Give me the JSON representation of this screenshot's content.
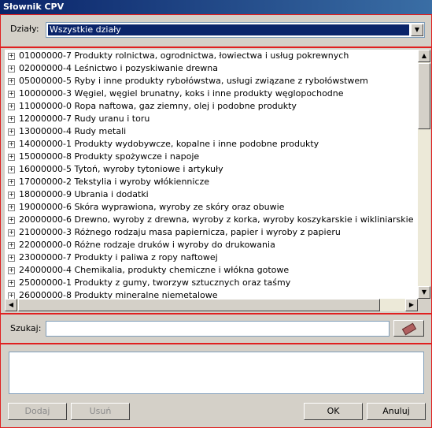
{
  "window": {
    "title": "Słownik CPV"
  },
  "filter": {
    "label": "Działy:",
    "selected": "Wszystkie działy"
  },
  "tree": {
    "items": [
      "01000000-7 Produkty rolnictwa, ogrodnictwa, łowiectwa i usług pokrewnych",
      "02000000-4 Leśnictwo i pozyskiwanie drewna",
      "05000000-5 Ryby i inne produkty rybołówstwa, usługi związane z rybołówstwem",
      "10000000-3 Węgiel, węgiel brunatny, koks i inne produkty węglopochodne",
      "11000000-0 Ropa naftowa, gaz ziemny, olej i podobne produkty",
      "12000000-7 Rudy uranu i toru",
      "13000000-4 Rudy metali",
      "14000000-1 Produkty wydobywcze, kopalne i inne podobne produkty",
      "15000000-8 Produkty spożywcze i napoje",
      "16000000-5 Tytoń, wyroby tytoniowe i artykuły",
      "17000000-2 Tekstylia i wyroby włókiennicze",
      "18000000-9 Ubrania i dodatki",
      "19000000-6 Skóra wyprawiona, wyroby ze skóry oraz obuwie",
      "20000000-6 Drewno, wyroby z drewna, wyroby z korka, wyroby koszykarskie i wikliniarskie",
      "21000000-3 Różnego rodzaju masa papiernicza, papier i wyroby z papieru",
      "22000000-0 Różne rodzaje druków i wyroby do drukowania",
      "23000000-7 Produkty i paliwa z ropy naftowej",
      "24000000-4 Chemikalia, produkty chemiczne i włókna gotowe",
      "25000000-1 Produkty z gumy, tworzyw sztucznych oraz taśmy",
      "26000000-8 Produkty mineralne niemetalowe"
    ]
  },
  "search": {
    "label": "Szukaj:",
    "value": "",
    "button_icon": "eraser-icon"
  },
  "buttons": {
    "add": "Dodaj",
    "remove": "Usuń",
    "ok": "OK",
    "cancel": "Anuluj"
  }
}
